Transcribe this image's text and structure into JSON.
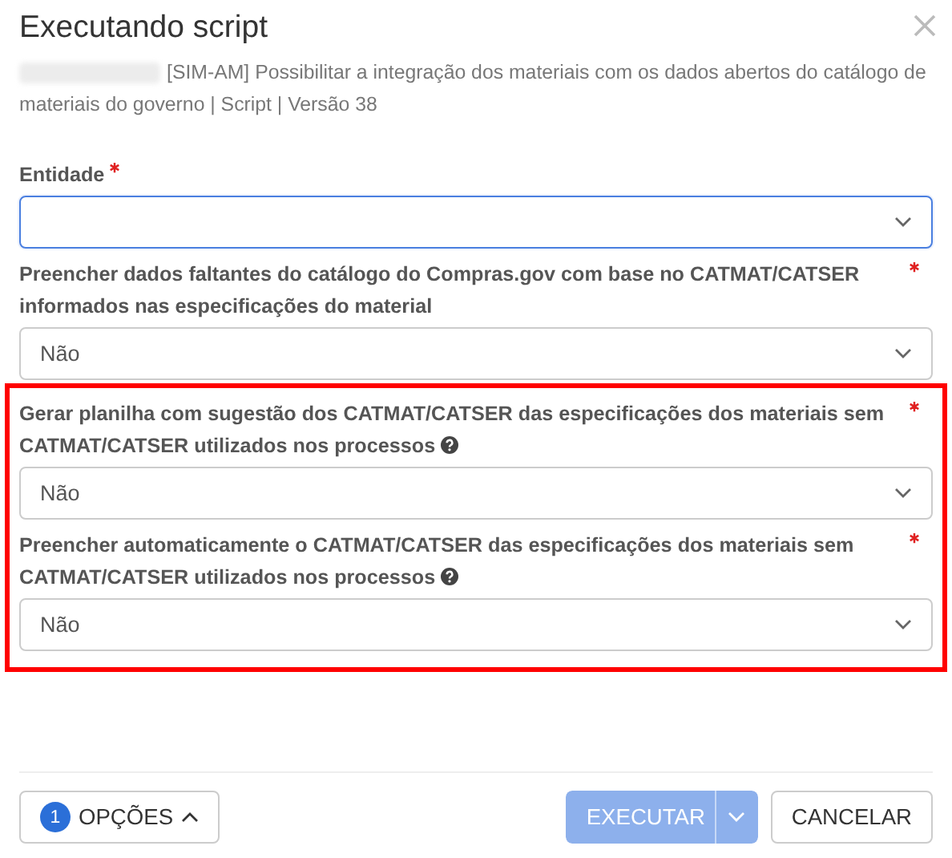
{
  "dialog": {
    "title": "Executando script",
    "redacted_prefix": true,
    "subtitle": "[SIM-AM] Possibilitar a integração dos materiais com os dados abertos do catálogo de materiais do governo | Script | Versão 38"
  },
  "fields": [
    {
      "label": "Entidade",
      "required": true,
      "help": false,
      "focused": true,
      "highlighted": false
    },
    {
      "label": "Preencher dados faltantes do catálogo do Compras.gov com base no CATMAT/CATSER informados nas especificações do material",
      "required": true,
      "help": false,
      "value": "Não",
      "focused": false,
      "highlighted": false
    },
    {
      "label": "Gerar planilha com sugestão dos CATMAT/CATSER das especificações dos materiais sem CATMAT/CATSER utilizados nos processos",
      "required": true,
      "help": true,
      "value": "Não",
      "focused": false,
      "highlighted": true
    },
    {
      "label": "Preencher automaticamente o CATMAT/CATSER das especificações dos materiais sem CATMAT/CATSER utilizados nos processos",
      "required": true,
      "help": true,
      "value": "Não",
      "focused": false,
      "highlighted": true
    }
  ],
  "footer": {
    "options_badge": "1",
    "options_label": "OPÇÕES",
    "execute_label": "EXECUTAR",
    "execute_disabled": true,
    "cancel_label": "CANCELAR"
  }
}
